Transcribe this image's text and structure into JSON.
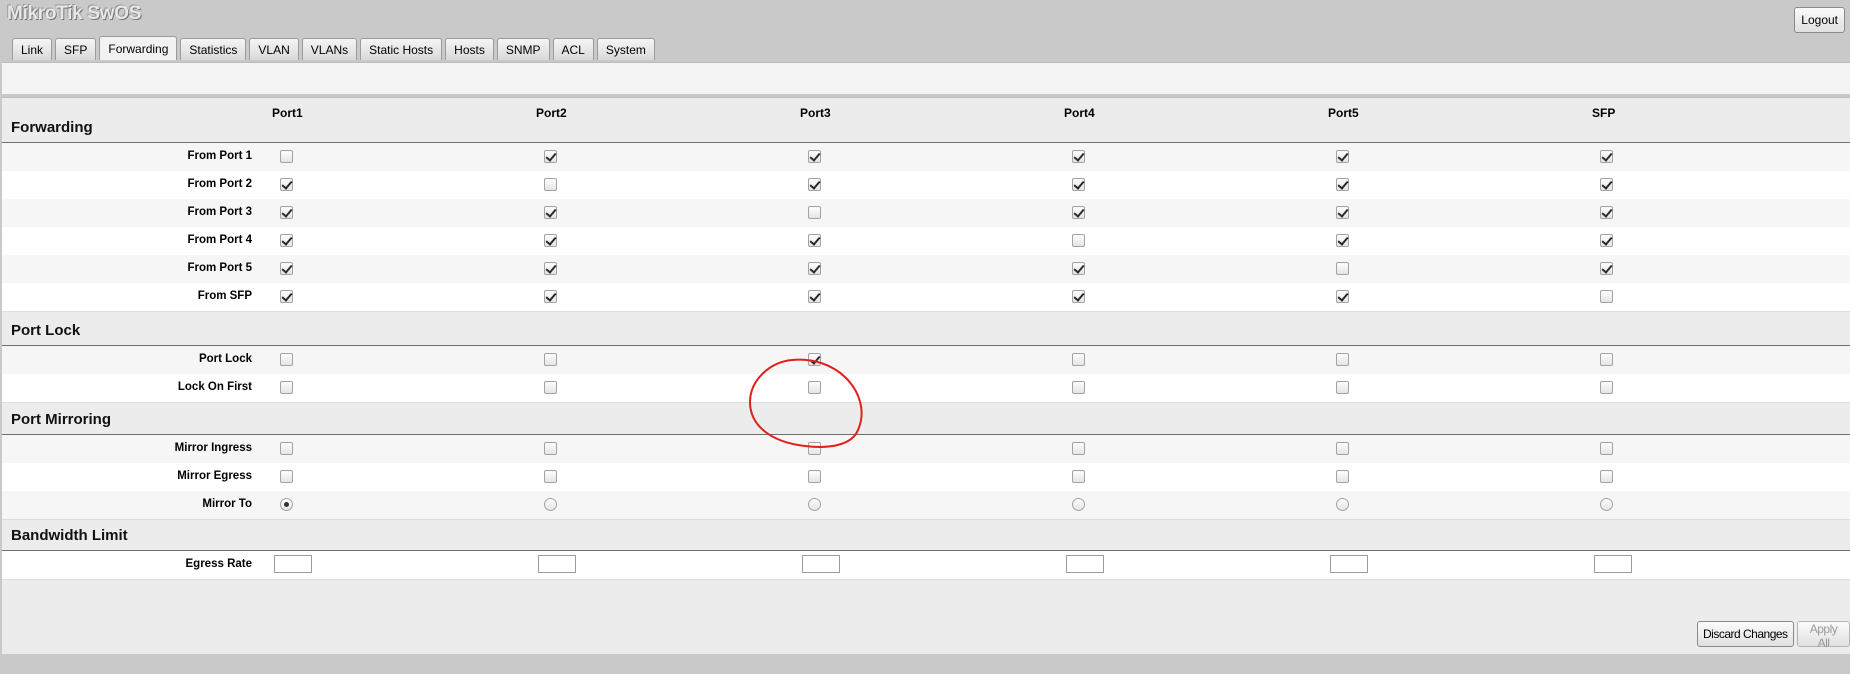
{
  "app": {
    "title": "MikroTik SwOS",
    "logout_label": "Logout"
  },
  "tabs": [
    "Link",
    "SFP",
    "Forwarding",
    "Statistics",
    "VLAN",
    "VLANs",
    "Static Hosts",
    "Hosts",
    "SNMP",
    "ACL",
    "System"
  ],
  "active_tab": "Forwarding",
  "ports": [
    "Port1",
    "Port2",
    "Port3",
    "Port4",
    "Port5",
    "SFP"
  ],
  "sections": {
    "forwarding": {
      "title": "Forwarding",
      "rows": [
        {
          "label": "From Port 1",
          "values": [
            false,
            true,
            true,
            true,
            true,
            true
          ]
        },
        {
          "label": "From Port 2",
          "values": [
            true,
            false,
            true,
            true,
            true,
            true
          ]
        },
        {
          "label": "From Port 3",
          "values": [
            true,
            true,
            false,
            true,
            true,
            true
          ]
        },
        {
          "label": "From Port 4",
          "values": [
            true,
            true,
            true,
            false,
            true,
            true
          ]
        },
        {
          "label": "From Port 5",
          "values": [
            true,
            true,
            true,
            true,
            false,
            true
          ]
        },
        {
          "label": "From SFP",
          "values": [
            true,
            true,
            true,
            true,
            true,
            false
          ]
        }
      ]
    },
    "port_lock": {
      "title": "Port Lock",
      "rows": [
        {
          "label": "Port Lock",
          "values": [
            false,
            false,
            true,
            false,
            false,
            false
          ]
        },
        {
          "label": "Lock On First",
          "values": [
            false,
            false,
            false,
            false,
            false,
            false
          ]
        }
      ]
    },
    "port_mirroring": {
      "title": "Port Mirroring",
      "rows": [
        {
          "label": "Mirror Ingress",
          "values": [
            false,
            false,
            false,
            false,
            false,
            false
          ]
        },
        {
          "label": "Mirror Egress",
          "values": [
            false,
            false,
            false,
            false,
            false,
            false
          ]
        }
      ],
      "mirror_to": {
        "label": "Mirror To",
        "selected_index": 0
      }
    },
    "bandwidth_limit": {
      "title": "Bandwidth Limit",
      "egress_rate": {
        "label": "Egress Rate",
        "values": [
          "",
          "",
          "",
          "",
          "",
          ""
        ]
      }
    }
  },
  "buttons": {
    "discard": "Discard Changes",
    "apply": "Apply All"
  },
  "colors": {
    "annotation": "#e0201c",
    "panel": "#ececec",
    "background": "#c9c9c9"
  }
}
